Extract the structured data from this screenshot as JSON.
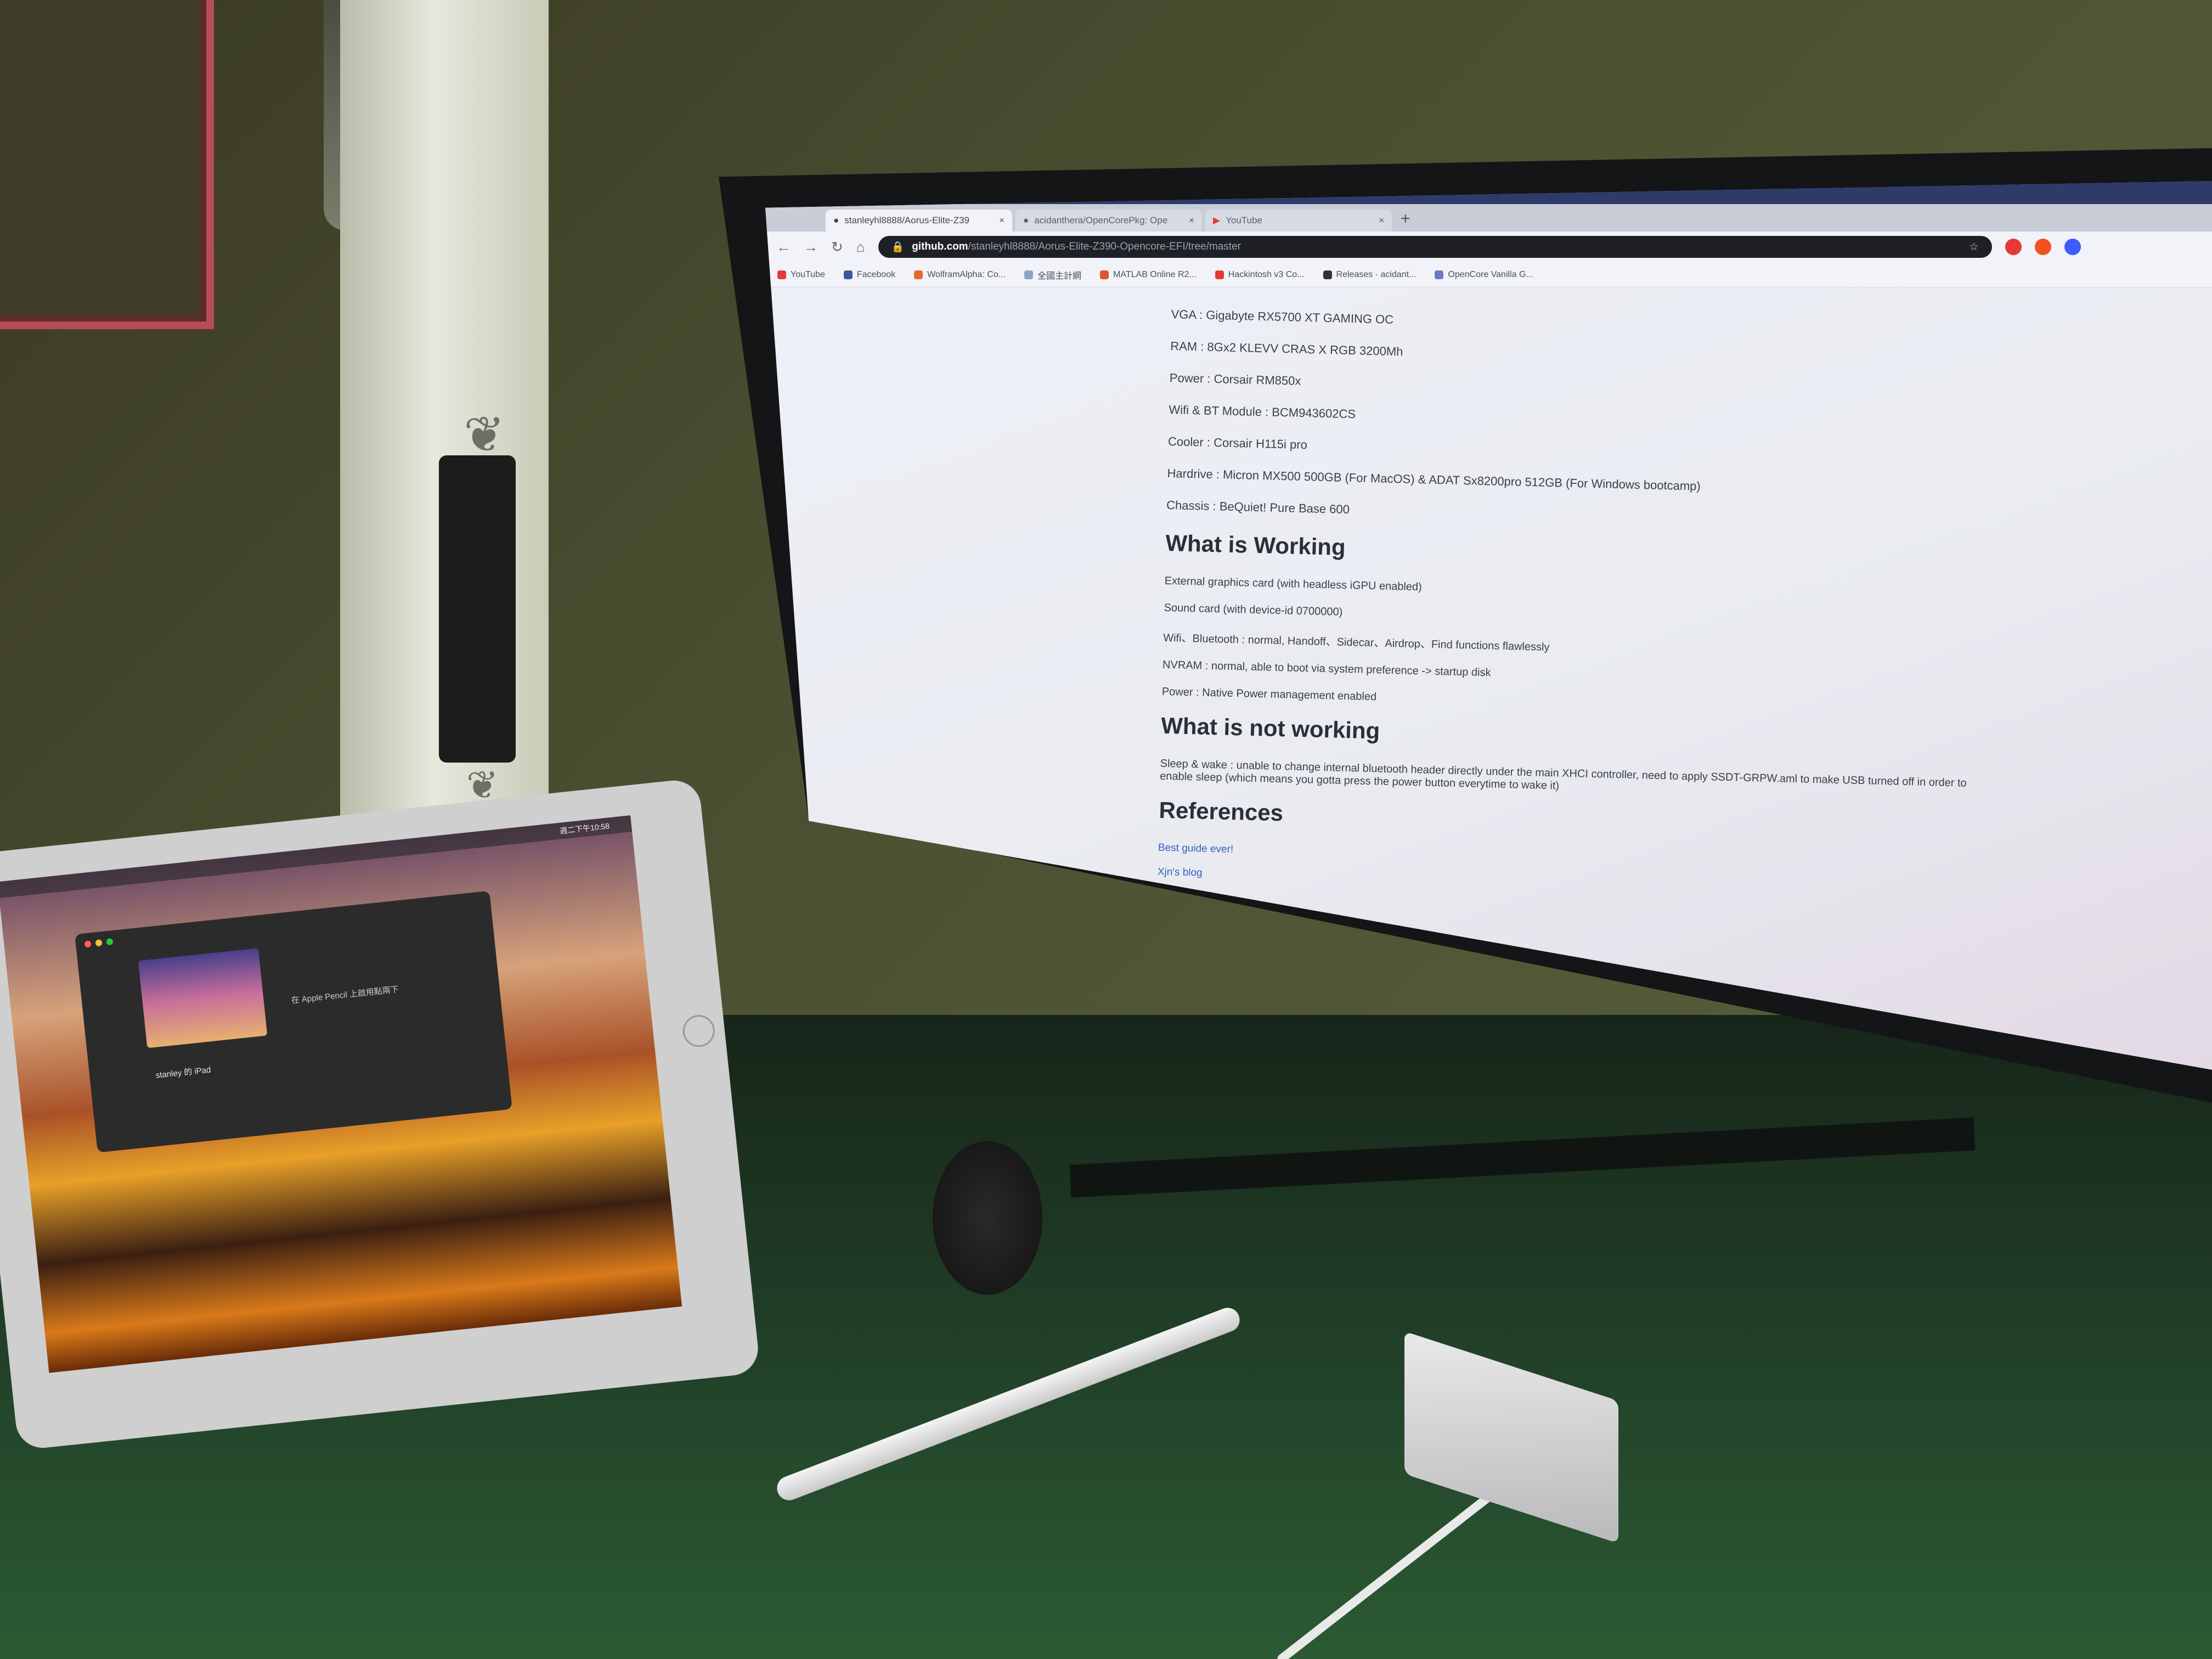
{
  "browser": {
    "tabs": [
      {
        "label": "stanleyhl8888/Aorus-Elite-Z39",
        "active": true
      },
      {
        "label": "acidanthera/OpenCorePkg: Ope",
        "active": false
      },
      {
        "label": "YouTube",
        "active": false
      }
    ],
    "new_tab_symbol": "+",
    "address": {
      "domain": "github.com",
      "path": "/stanleyhl8888/Aorus-Elite-Z390-Opencore-EFI/tree/master"
    },
    "bookmarks": [
      {
        "label": "YouTube",
        "color": "#e53935"
      },
      {
        "label": "Facebook",
        "color": "#3b5998"
      },
      {
        "label": "WolframAlpha: Co...",
        "color": "#e46a2b"
      },
      {
        "label": "全國主計網",
        "color": "#8aa2c8"
      },
      {
        "label": "MATLAB Online R2...",
        "color": "#d9572b"
      },
      {
        "label": "Hackintosh v3 Co...",
        "color": "#e53935"
      },
      {
        "label": "Releases · acidant...",
        "color": "#333333"
      },
      {
        "label": "OpenCore Vanilla G...",
        "color": "#6c79c6"
      }
    ]
  },
  "readme": {
    "specs": [
      "VGA : Gigabyte RX5700 XT GAMING OC",
      "RAM : 8Gx2 KLEVV CRAS X RGB 3200Mh",
      "Power : Corsair RM850x",
      "Wifi & BT Module : BCM943602CS",
      "Cooler : Corsair H115i pro",
      "Hardrive : Micron MX500 500GB (For MacOS) & ADAT Sx8200pro 512GB (For Windows bootcamp)",
      "Chassis : BeQuiet! Pure Base 600"
    ],
    "working_heading": "What is Working",
    "working": [
      "External graphics card (with headless iGPU enabled)",
      "Sound card (with device-id 0700000)",
      "Wifi、Bluetooth : normal, Handoff、Sidecar、Airdrop、Find functions flawlessly",
      "NVRAM : normal, able to boot via system preference -> startup disk",
      "Power : Native Power management enabled"
    ],
    "not_working_heading": "What is not working",
    "not_working": [
      "Sleep & wake : unable to change internal bluetooth header directly under the main XHCI controller, need to apply SSDT-GRPW.aml to make USB turned off in order to enable sleep (which means you gotta press the power button everytime to wake it)"
    ],
    "references_heading": "References",
    "references": [
      "Best guide ever!",
      "Xjn's blog"
    ]
  },
  "ipad": {
    "clock": "週二下午10:58",
    "device_name": "stanley 的 iPad",
    "option_label": "在 Apple Pencil 上啟用點兩下"
  },
  "dock_icons": [
    "finder-icon",
    "launchpad-icon",
    "safari-icon",
    "mail-icon",
    "photos-icon",
    "calendar-icon",
    "spotify-icon",
    "chrome-icon",
    "app-store-icon",
    "line-icon",
    "system-preferences-icon",
    "terminal-icon",
    "trash-icon"
  ]
}
